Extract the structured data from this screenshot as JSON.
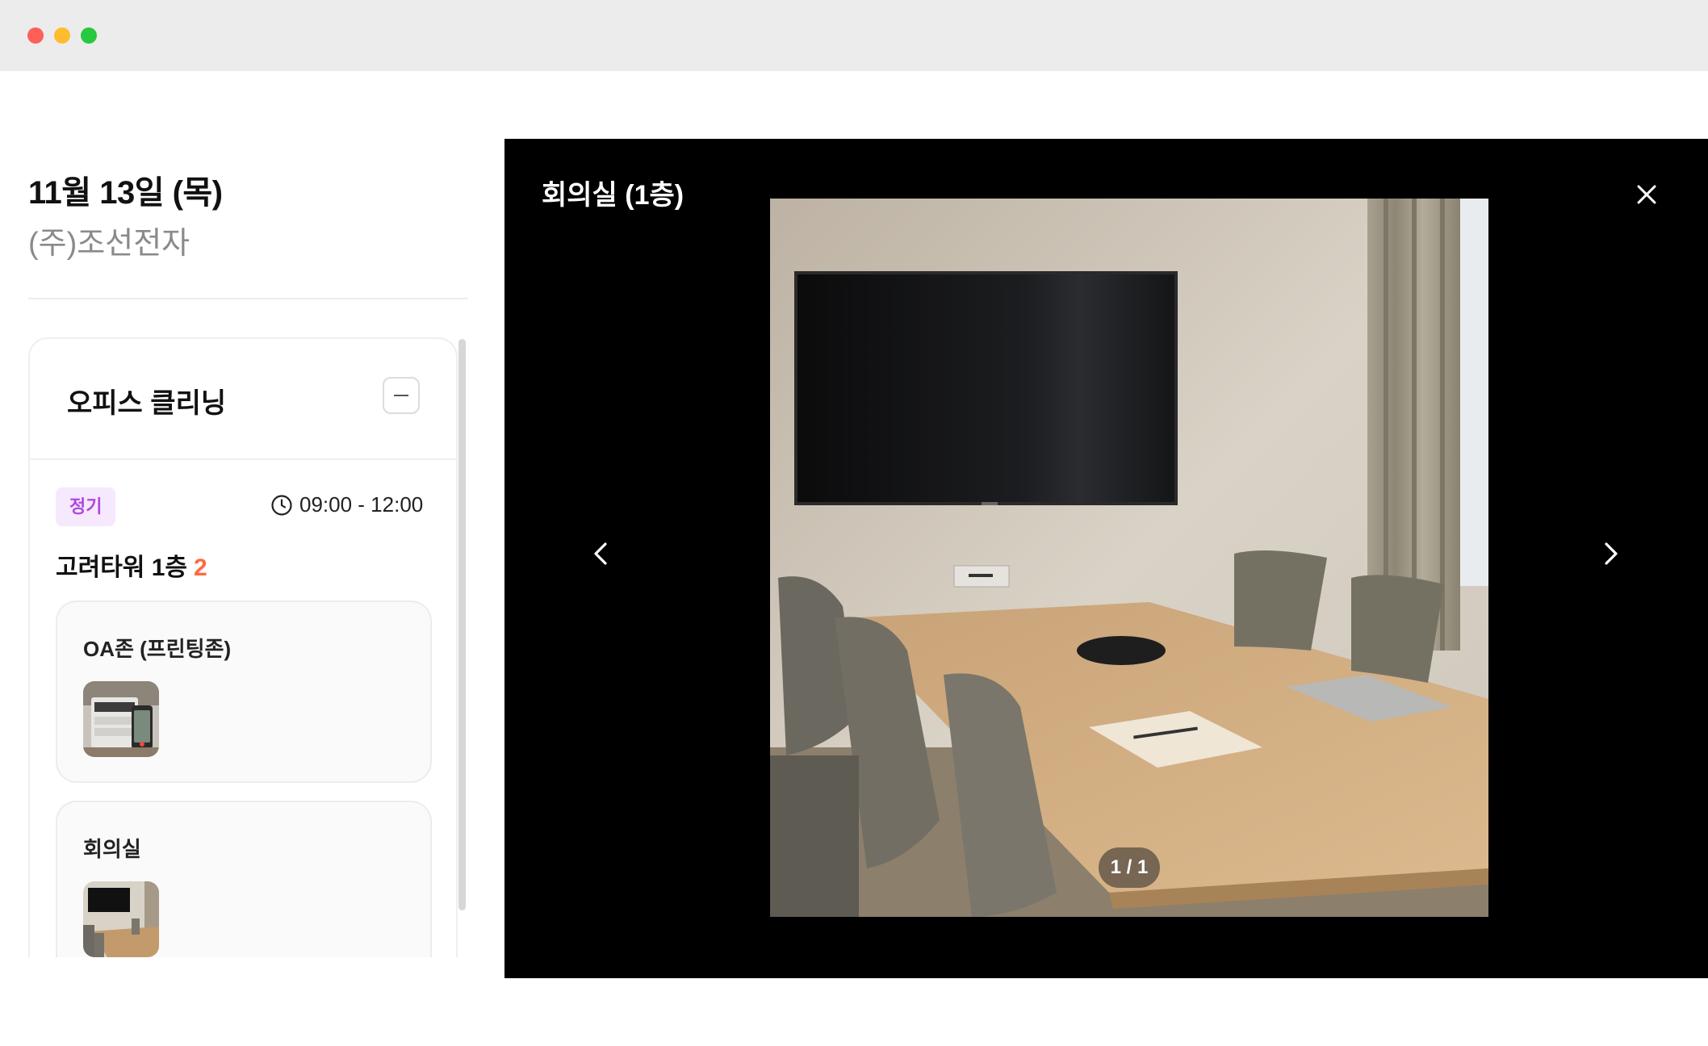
{
  "window": {
    "controls": [
      "close",
      "minimize",
      "zoom"
    ]
  },
  "schedule": {
    "date": "11월 13일 (목)",
    "company": "(주)조선전자"
  },
  "service": {
    "title": "오피스 클리닝",
    "badge": "정기",
    "time": "09:00 - 12:00",
    "location": "고려타워 1층",
    "location_count": "2",
    "zones": [
      {
        "title": "OA존 (프린팅존)",
        "thumb_icon": "printer-photo"
      },
      {
        "title": "회의실",
        "thumb_icon": "meeting-room-photo"
      }
    ]
  },
  "viewer": {
    "title": "회의실 (1층)",
    "counter": "1 / 1",
    "close_icon": "close-icon",
    "prev_icon": "chevron-left-icon",
    "next_icon": "chevron-right-icon"
  },
  "colors": {
    "badge_bg": "#f6e8fd",
    "badge_text": "#b047e0",
    "count_accent": "#ff6a3d",
    "viewer_bg": "#000000"
  }
}
